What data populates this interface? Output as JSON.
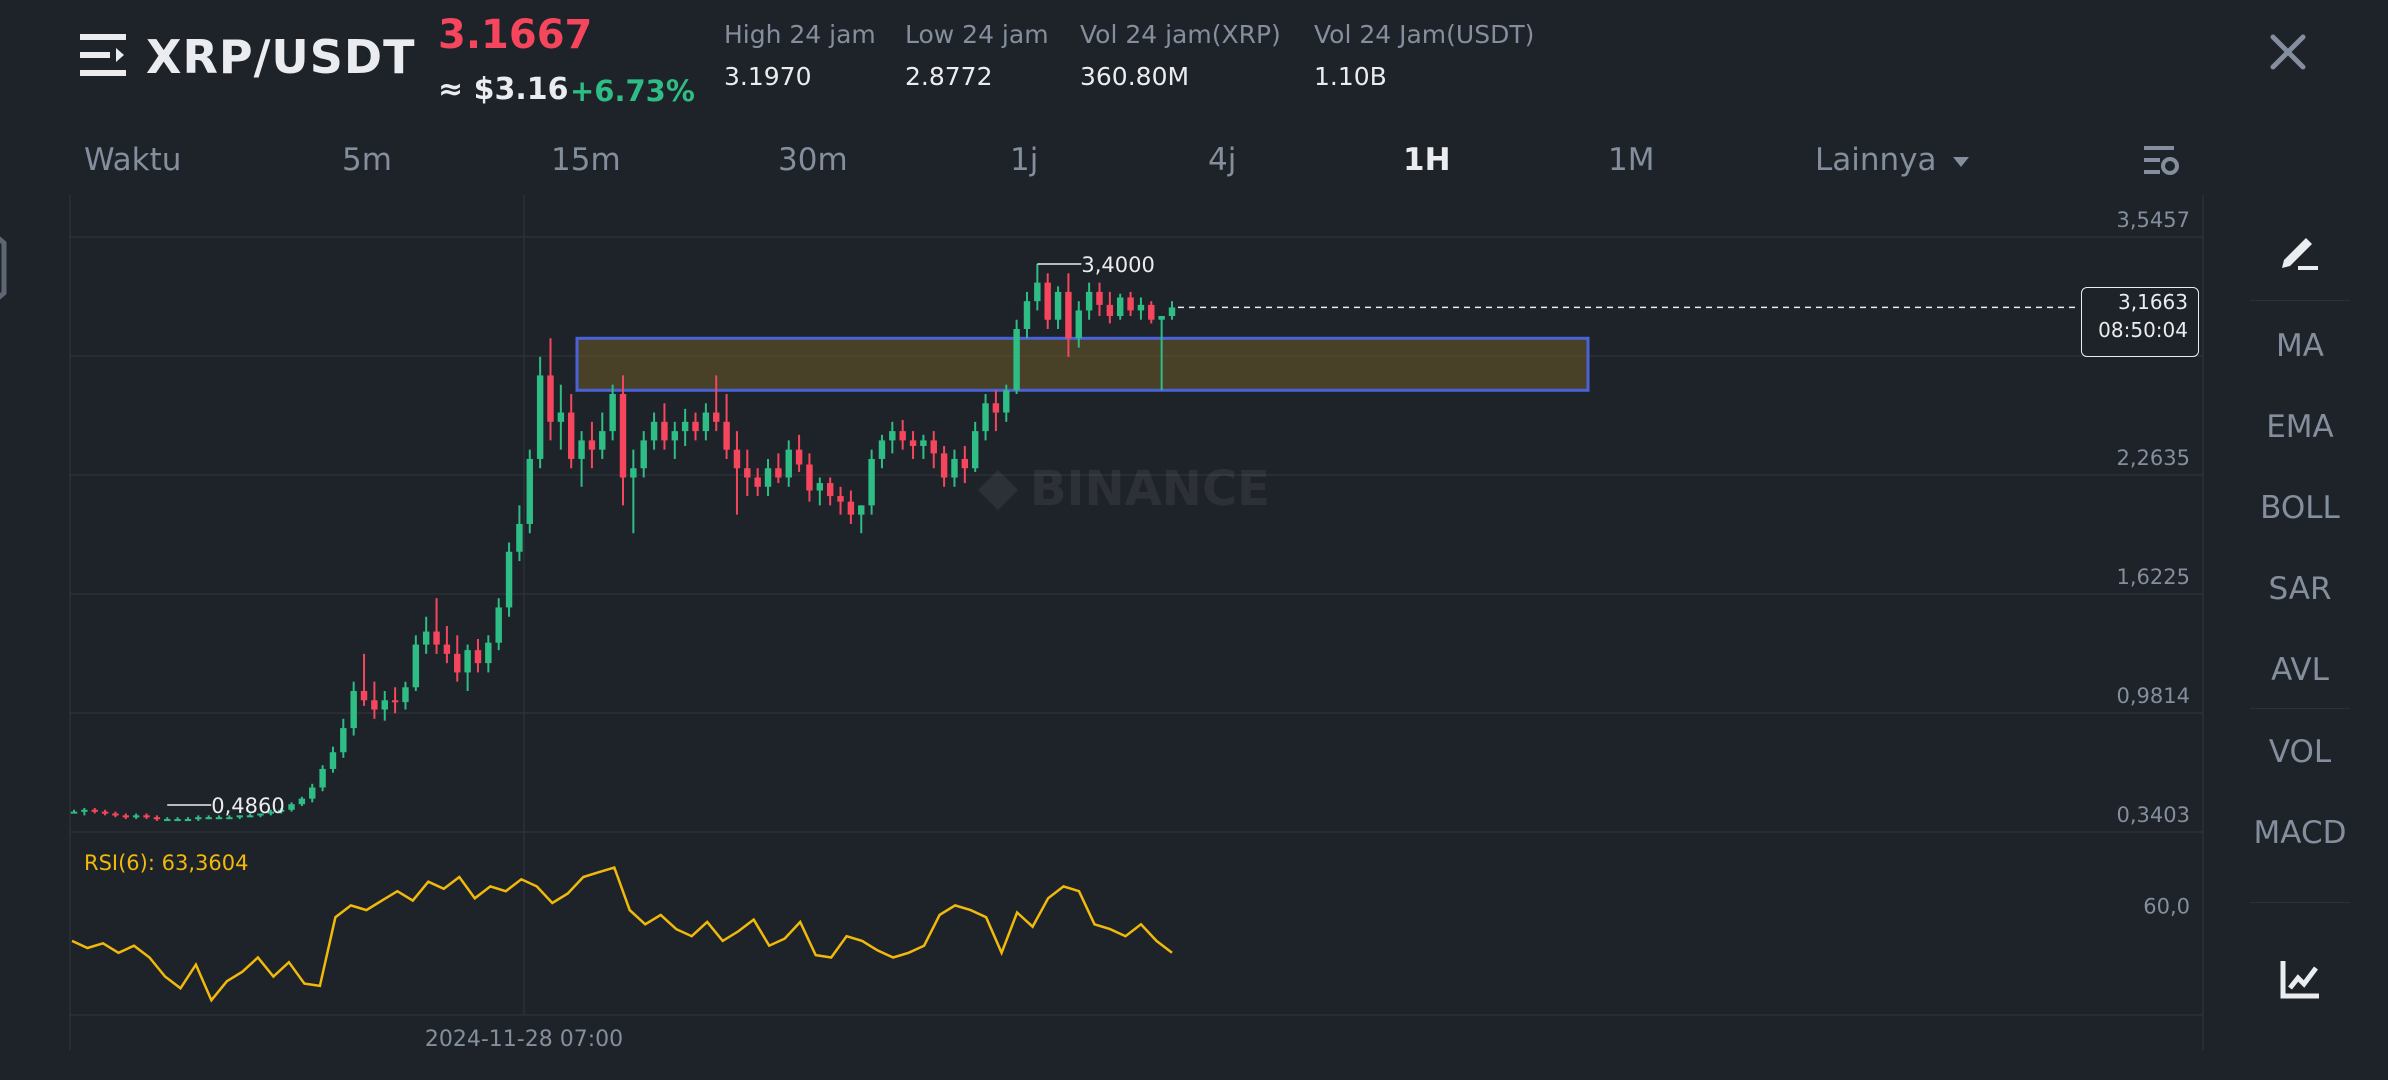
{
  "header": {
    "pair": "XRP/USDT",
    "last_price": "3.1667",
    "approx_usd": "≈ $3.16",
    "change_pct": "+6.73%",
    "stats": [
      {
        "label": "High 24 jam",
        "value": "3.1970"
      },
      {
        "label": "Low 24 jam",
        "value": "2.8772"
      },
      {
        "label": "Vol 24 jam(XRP)",
        "value": "360.80M"
      },
      {
        "label": "Vol 24 Jam(USDT)",
        "value": "1.10B"
      }
    ]
  },
  "timeframes": [
    {
      "label": "Waktu",
      "active": false
    },
    {
      "label": "5m",
      "active": false
    },
    {
      "label": "15m",
      "active": false
    },
    {
      "label": "30m",
      "active": false
    },
    {
      "label": "1j",
      "active": false
    },
    {
      "label": "4j",
      "active": false
    },
    {
      "label": "1H",
      "active": true
    },
    {
      "label": "1M",
      "active": false
    },
    {
      "label": "Lainnya",
      "active": false
    }
  ],
  "sidebar": {
    "indicators": [
      "MA",
      "EMA",
      "BOLL",
      "SAR",
      "AVL",
      "VOL",
      "MACD"
    ]
  },
  "chart_data": {
    "type": "candlestick",
    "watermark": "BINANCE",
    "y_ticks": [
      "3,5457",
      "2,2635",
      "1,6225",
      "0,9814",
      "0,3403"
    ],
    "ylim": [
      0.3403,
      3.5457
    ],
    "current_price_label": "3,1663",
    "countdown_label": "08:50:04",
    "high_marker": {
      "value": 3.4,
      "label": "3,4000"
    },
    "low_marker": {
      "value": 0.486,
      "label": "0,4860"
    },
    "zone": {
      "low": 2.72,
      "high": 3.0
    },
    "x_tick_label": "2024-11-28 07:00",
    "candles": [
      [
        0.45,
        0.46,
        0.44,
        0.45
      ],
      [
        0.45,
        0.47,
        0.43,
        0.46
      ],
      [
        0.46,
        0.47,
        0.44,
        0.45
      ],
      [
        0.45,
        0.46,
        0.43,
        0.44
      ],
      [
        0.44,
        0.45,
        0.42,
        0.43
      ],
      [
        0.43,
        0.44,
        0.41,
        0.42
      ],
      [
        0.42,
        0.44,
        0.41,
        0.43
      ],
      [
        0.43,
        0.44,
        0.41,
        0.42
      ],
      [
        0.42,
        0.43,
        0.4,
        0.41
      ],
      [
        0.41,
        0.42,
        0.4,
        0.41
      ],
      [
        0.41,
        0.42,
        0.4,
        0.41
      ],
      [
        0.41,
        0.42,
        0.4,
        0.41
      ],
      [
        0.41,
        0.43,
        0.4,
        0.42
      ],
      [
        0.42,
        0.43,
        0.41,
        0.42
      ],
      [
        0.42,
        0.43,
        0.41,
        0.42
      ],
      [
        0.42,
        0.43,
        0.41,
        0.42
      ],
      [
        0.42,
        0.43,
        0.41,
        0.43
      ],
      [
        0.43,
        0.44,
        0.42,
        0.43
      ],
      [
        0.43,
        0.44,
        0.42,
        0.44
      ],
      [
        0.44,
        0.46,
        0.43,
        0.45
      ],
      [
        0.45,
        0.47,
        0.44,
        0.46
      ],
      [
        0.46,
        0.5,
        0.45,
        0.49
      ],
      [
        0.49,
        0.53,
        0.48,
        0.52
      ],
      [
        0.52,
        0.6,
        0.5,
        0.58
      ],
      [
        0.58,
        0.7,
        0.56,
        0.68
      ],
      [
        0.68,
        0.8,
        0.66,
        0.77
      ],
      [
        0.77,
        0.95,
        0.74,
        0.9
      ],
      [
        0.9,
        1.15,
        0.86,
        1.1
      ],
      [
        1.1,
        1.3,
        1.02,
        1.05
      ],
      [
        1.05,
        1.15,
        0.95,
        1.0
      ],
      [
        1.0,
        1.1,
        0.94,
        1.05
      ],
      [
        1.05,
        1.12,
        0.98,
        1.04
      ],
      [
        1.04,
        1.15,
        1.0,
        1.12
      ],
      [
        1.12,
        1.4,
        1.1,
        1.35
      ],
      [
        1.35,
        1.5,
        1.3,
        1.42
      ],
      [
        1.42,
        1.6,
        1.3,
        1.35
      ],
      [
        1.35,
        1.45,
        1.25,
        1.3
      ],
      [
        1.3,
        1.4,
        1.15,
        1.2
      ],
      [
        1.2,
        1.35,
        1.1,
        1.32
      ],
      [
        1.32,
        1.38,
        1.2,
        1.25
      ],
      [
        1.25,
        1.4,
        1.2,
        1.36
      ],
      [
        1.36,
        1.6,
        1.32,
        1.55
      ],
      [
        1.55,
        1.9,
        1.5,
        1.85
      ],
      [
        1.85,
        2.1,
        1.8,
        2.0
      ],
      [
        2.0,
        2.4,
        1.95,
        2.35
      ],
      [
        2.35,
        2.9,
        2.3,
        2.8
      ],
      [
        2.8,
        3.0,
        2.45,
        2.55
      ],
      [
        2.55,
        2.75,
        2.4,
        2.6
      ],
      [
        2.6,
        2.7,
        2.3,
        2.35
      ],
      [
        2.35,
        2.5,
        2.2,
        2.45
      ],
      [
        2.45,
        2.55,
        2.3,
        2.4
      ],
      [
        2.4,
        2.6,
        2.35,
        2.5
      ],
      [
        2.5,
        2.75,
        2.45,
        2.7
      ],
      [
        2.7,
        2.8,
        2.1,
        2.25
      ],
      [
        2.25,
        2.4,
        1.95,
        2.3
      ],
      [
        2.3,
        2.5,
        2.25,
        2.45
      ],
      [
        2.45,
        2.6,
        2.4,
        2.55
      ],
      [
        2.55,
        2.65,
        2.4,
        2.45
      ],
      [
        2.45,
        2.55,
        2.35,
        2.5
      ],
      [
        2.5,
        2.62,
        2.42,
        2.55
      ],
      [
        2.55,
        2.6,
        2.45,
        2.5
      ],
      [
        2.5,
        2.65,
        2.45,
        2.6
      ],
      [
        2.6,
        2.8,
        2.5,
        2.55
      ],
      [
        2.55,
        2.7,
        2.35,
        2.4
      ],
      [
        2.4,
        2.5,
        2.05,
        2.3
      ],
      [
        2.3,
        2.4,
        2.15,
        2.25
      ],
      [
        2.25,
        2.3,
        2.15,
        2.2
      ],
      [
        2.2,
        2.35,
        2.15,
        2.3
      ],
      [
        2.3,
        2.38,
        2.22,
        2.25
      ],
      [
        2.25,
        2.45,
        2.2,
        2.4
      ],
      [
        2.4,
        2.48,
        2.28,
        2.32
      ],
      [
        2.32,
        2.38,
        2.12,
        2.18
      ],
      [
        2.18,
        2.25,
        2.1,
        2.22
      ],
      [
        2.22,
        2.25,
        2.1,
        2.15
      ],
      [
        2.15,
        2.2,
        2.05,
        2.12
      ],
      [
        2.12,
        2.18,
        2.0,
        2.05
      ],
      [
        2.05,
        2.1,
        1.95,
        2.1
      ],
      [
        2.1,
        2.4,
        2.05,
        2.35
      ],
      [
        2.35,
        2.48,
        2.3,
        2.45
      ],
      [
        2.45,
        2.55,
        2.38,
        2.5
      ],
      [
        2.5,
        2.56,
        2.4,
        2.45
      ],
      [
        2.45,
        2.5,
        2.35,
        2.42
      ],
      [
        2.42,
        2.48,
        2.35,
        2.45
      ],
      [
        2.45,
        2.5,
        2.3,
        2.38
      ],
      [
        2.38,
        2.42,
        2.2,
        2.25
      ],
      [
        2.25,
        2.4,
        2.2,
        2.35
      ],
      [
        2.35,
        2.42,
        2.22,
        2.3
      ],
      [
        2.3,
        2.55,
        2.28,
        2.5
      ],
      [
        2.5,
        2.7,
        2.45,
        2.65
      ],
      [
        2.65,
        2.72,
        2.5,
        2.6
      ],
      [
        2.6,
        2.75,
        2.55,
        2.72
      ],
      [
        2.72,
        3.1,
        2.7,
        3.05
      ],
      [
        3.05,
        3.25,
        3.0,
        3.2
      ],
      [
        3.2,
        3.4,
        3.15,
        3.3
      ],
      [
        3.3,
        3.35,
        3.05,
        3.1
      ],
      [
        3.1,
        3.28,
        3.05,
        3.25
      ],
      [
        3.25,
        3.35,
        2.9,
        3.0
      ],
      [
        3.0,
        3.2,
        2.95,
        3.15
      ],
      [
        3.15,
        3.3,
        3.1,
        3.25
      ],
      [
        3.25,
        3.3,
        3.12,
        3.18
      ],
      [
        3.18,
        3.25,
        3.08,
        3.12
      ],
      [
        3.12,
        3.24,
        3.1,
        3.22
      ],
      [
        3.22,
        3.25,
        3.12,
        3.15
      ],
      [
        3.15,
        3.22,
        3.1,
        3.18
      ],
      [
        3.18,
        3.2,
        3.08,
        3.1
      ],
      [
        3.1,
        3.12,
        2.72,
        3.12
      ],
      [
        3.12,
        3.2,
        3.1,
        3.1663
      ]
    ],
    "rsi": {
      "label": "RSI(6): 63,3604",
      "tick": "60,0",
      "values": [
        45,
        42,
        44,
        40,
        43,
        38,
        30,
        25,
        35,
        20,
        28,
        32,
        38,
        30,
        36,
        27,
        26,
        55,
        60,
        58,
        62,
        66,
        62,
        70,
        67,
        72,
        63,
        68,
        66,
        71,
        68,
        61,
        65,
        72,
        74,
        76,
        58,
        52,
        56,
        50,
        47,
        53,
        45,
        49,
        54,
        43,
        46,
        53,
        39,
        38,
        47,
        45,
        41,
        38,
        40,
        43,
        56,
        60,
        58,
        55,
        40,
        57,
        51,
        63,
        68,
        66,
        52,
        50,
        47,
        52,
        45,
        40
      ]
    }
  }
}
